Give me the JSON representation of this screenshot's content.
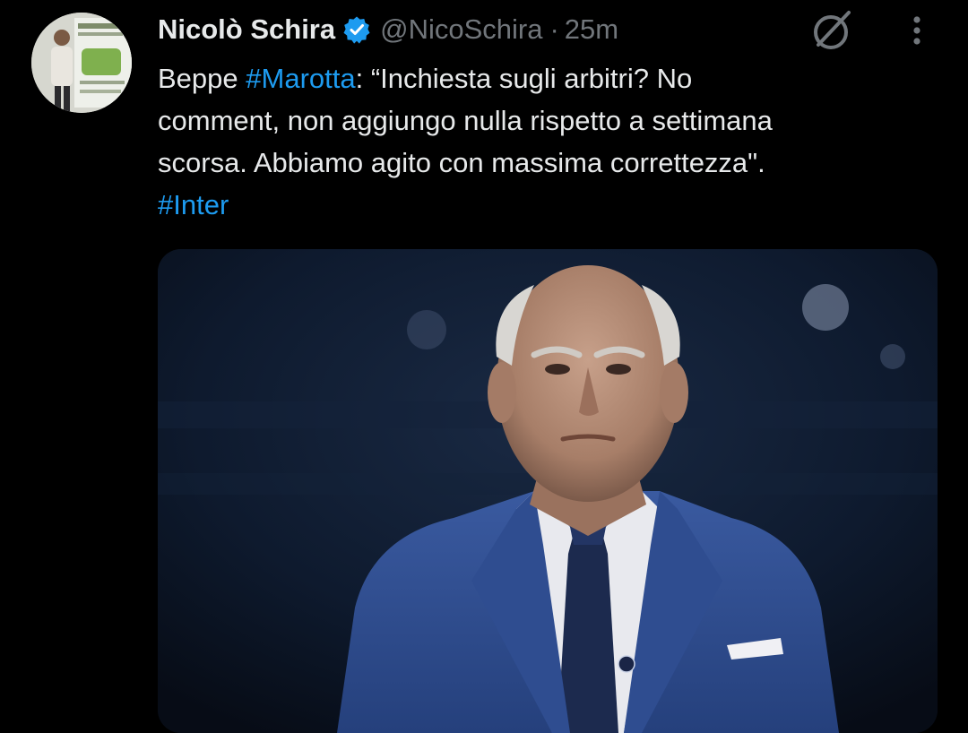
{
  "tweet": {
    "author": {
      "display_name": "Nicolò Schira",
      "handle": "@NicoSchira",
      "verified": true
    },
    "separator": "·",
    "time": "25m",
    "text": {
      "line1_prefix": "Beppe ",
      "line1_hashtag": "#Marotta",
      "line1_suffix": ": “Inchiesta sugli arbitri? No",
      "line2": "comment, non aggiungo nulla rispetto a settimana",
      "line3": "scorsa. Abbiamo agito con massima correttezza\".",
      "line4_hashtag": "#Inter"
    },
    "icons": {
      "verified": "verified-badge-icon",
      "grok": "grok-icon",
      "more": "more-vertical-icon"
    },
    "colors": {
      "background": "#000000",
      "text": "#e7e9ea",
      "secondary_text": "#71767b",
      "link": "#1d9bf0",
      "verified": "#1d9bf0"
    }
  }
}
